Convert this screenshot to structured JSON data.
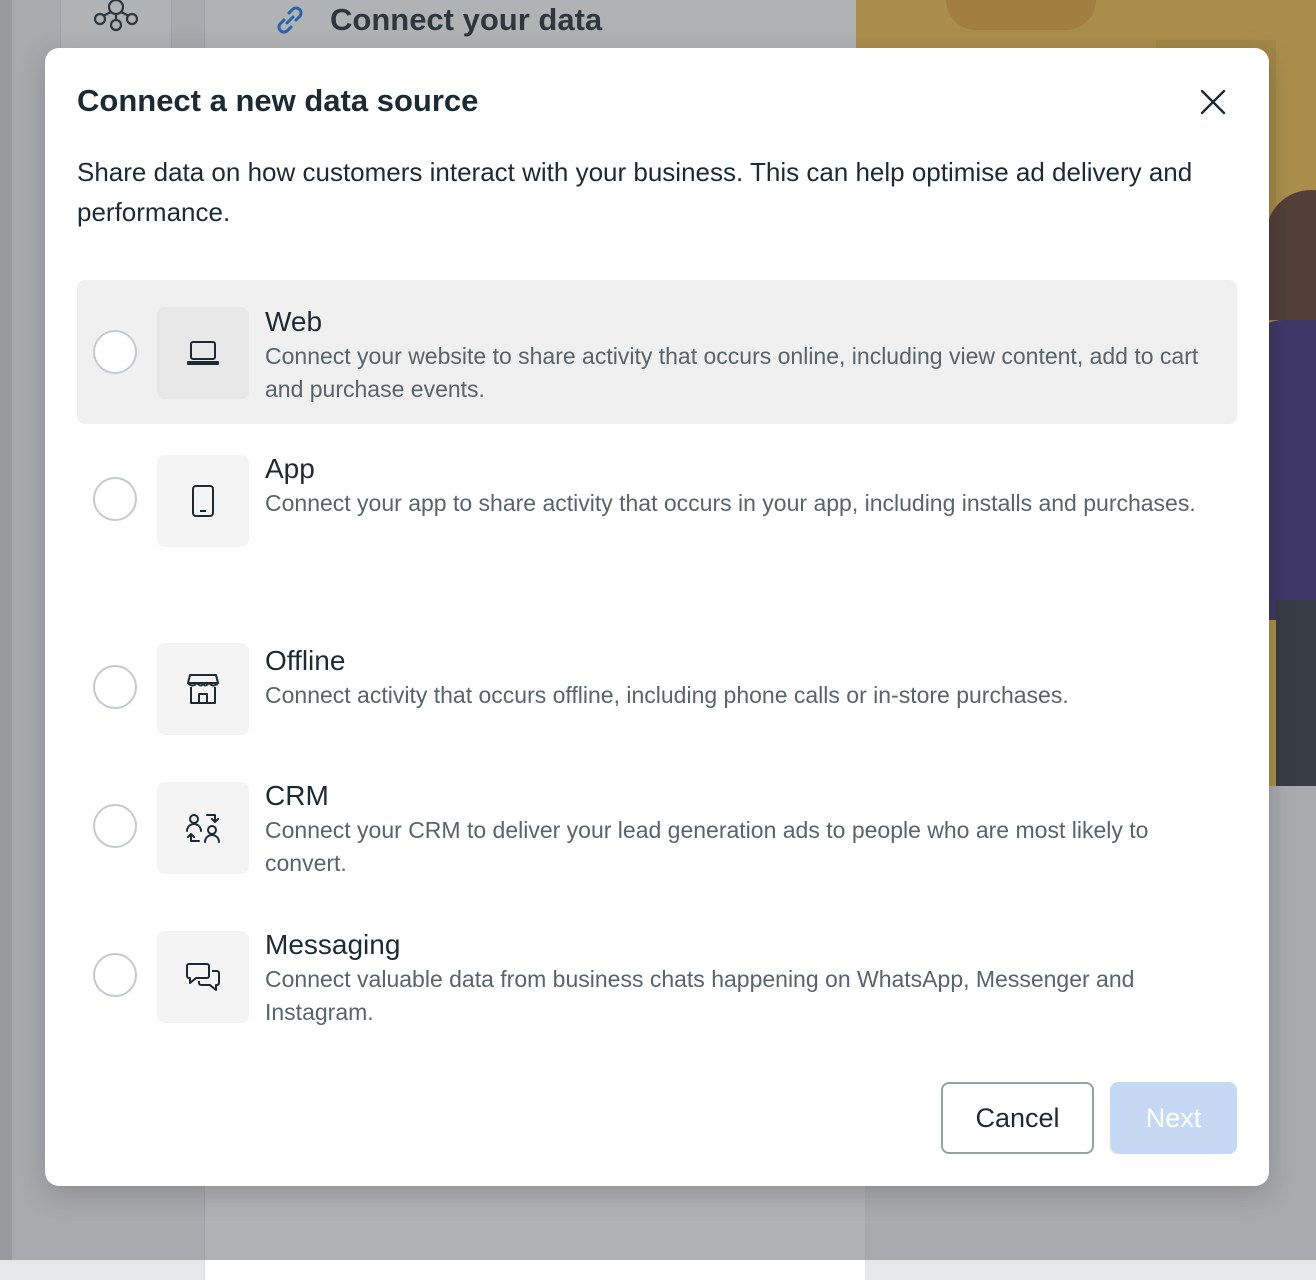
{
  "background": {
    "heading": "Connect your data"
  },
  "modal": {
    "title": "Connect a new data source",
    "description": "Share data on how customers interact with your business. This can help optimise ad delivery and performance.",
    "options": [
      {
        "title": "Web",
        "description": "Connect your website to share activity that occurs online, including view content, add to cart and purchase events.",
        "icon": "laptop-icon",
        "state": "hovered"
      },
      {
        "title": "App",
        "description": "Connect your app to share activity that occurs in your app, including installs and purchases.",
        "icon": "phone-icon"
      },
      {
        "title": "Offline",
        "description": "Connect activity that occurs offline, including phone calls or in-store purchases.",
        "icon": "store-icon"
      },
      {
        "title": "CRM",
        "description": "Connect your CRM to deliver your lead generation ads to people who are most likely to convert.",
        "icon": "people-sync-icon"
      },
      {
        "title": "Messaging",
        "description": "Connect valuable data from business chats happening on WhatsApp, Messenger and Instagram.",
        "icon": "chat-bubbles-icon"
      }
    ],
    "buttons": {
      "cancel": "Cancel",
      "next": "Next",
      "next_disabled": true
    }
  },
  "colors": {
    "primary_text": "#1c2b33",
    "secondary_text": "#5a6368",
    "next_disabled_bg": "#c5d9f5",
    "hover_bg": "#f0f0f0"
  }
}
